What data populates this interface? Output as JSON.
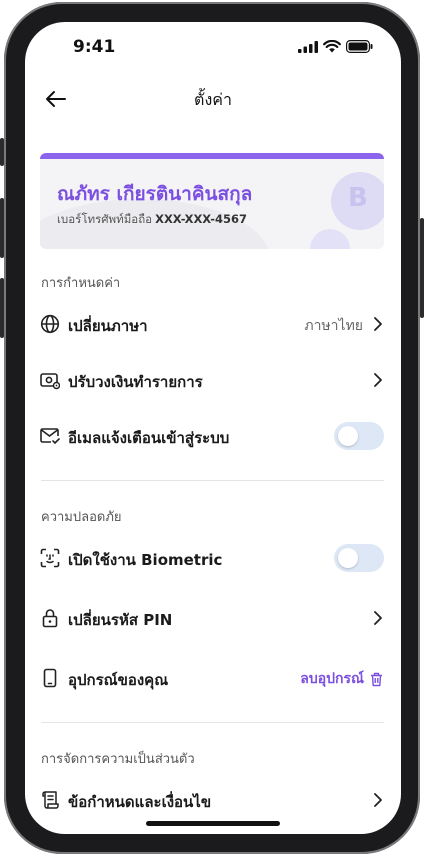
{
  "status_bar": {
    "time": "9:41"
  },
  "header": {
    "title": "ตั้งค่า"
  },
  "profile": {
    "name": "ณภัทร เกียรตินาคินสกุล",
    "phone_label": "เบอร์โทรศัพท์มือถือ",
    "phone_number": "XXX-XXX-4567",
    "coin_symbol": "B"
  },
  "sections": {
    "settings": {
      "title": "การกำหนดค่า",
      "change_language": {
        "label": "เปลี่ยนภาษา",
        "value": "ภาษาไทย"
      },
      "adjust_limit": {
        "label": "ปรับวงเงินทำรายการ"
      },
      "email_login_alert": {
        "label": "อีเมลแจ้งเตือนเข้าสู่ระบบ",
        "enabled": false
      }
    },
    "security": {
      "title": "ความปลอดภัย",
      "biometric": {
        "label": "เปิดใช้งาน Biometric",
        "enabled": false
      },
      "change_pin": {
        "label": "เปลี่ยนรหัส PIN"
      },
      "devices": {
        "label": "อุปกรณ์ของคุณ",
        "action": "ลบอุปกรณ์"
      }
    },
    "privacy": {
      "title": "การจัดการความเป็นส่วนตัว",
      "terms": {
        "label": "ข้อกำหนดและเงื่อนไข"
      }
    }
  },
  "colors": {
    "accent": "#7b4fe0",
    "toggle_off": "#dde7f6",
    "frame": "#1b1b1d"
  }
}
